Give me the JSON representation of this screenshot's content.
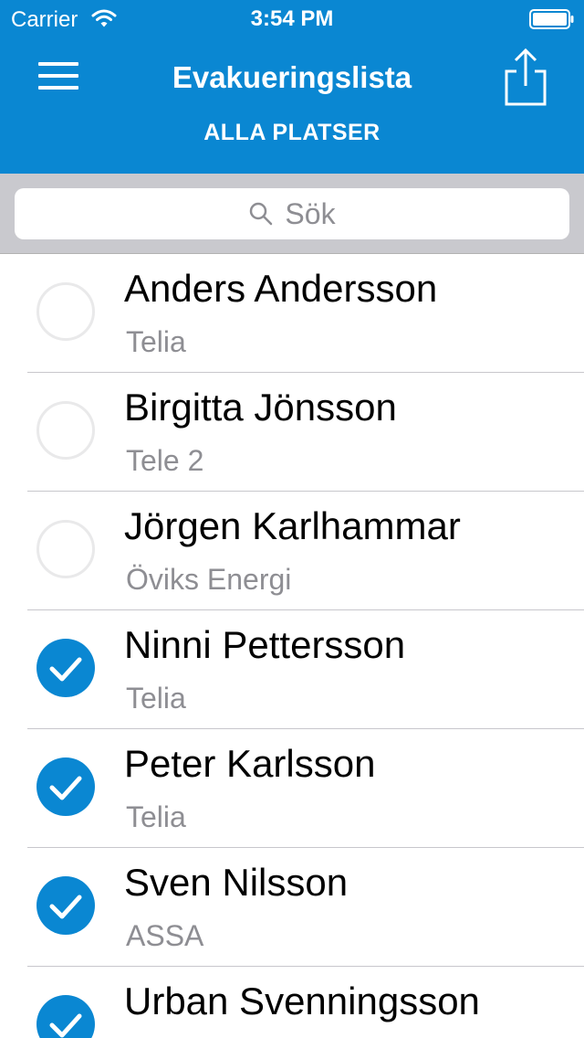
{
  "status_bar": {
    "carrier": "Carrier",
    "time": "3:54 PM"
  },
  "nav": {
    "title": "Evakueringslista",
    "subtitle": "ALLA PLATSER",
    "menu_icon": "hamburger-menu-icon",
    "share_icon": "share-icon"
  },
  "search": {
    "placeholder": "Sök",
    "icon": "search-icon"
  },
  "colors": {
    "accent": "#0a87d2",
    "search_bar_bg": "#c9c9ce",
    "secondary_text": "#8e8e93"
  },
  "people": [
    {
      "name": "Anders Andersson",
      "company": "Telia",
      "checked": false
    },
    {
      "name": "Birgitta Jönsson",
      "company": "Tele 2",
      "checked": false
    },
    {
      "name": "Jörgen Karlhammar",
      "company": "Öviks Energi",
      "checked": false
    },
    {
      "name": "Ninni Pettersson",
      "company": "Telia",
      "checked": true
    },
    {
      "name": "Peter Karlsson",
      "company": "Telia",
      "checked": true
    },
    {
      "name": "Sven Nilsson",
      "company": "ASSA",
      "checked": true
    },
    {
      "name": "Urban Svenningsson",
      "company": "",
      "checked": true
    }
  ]
}
